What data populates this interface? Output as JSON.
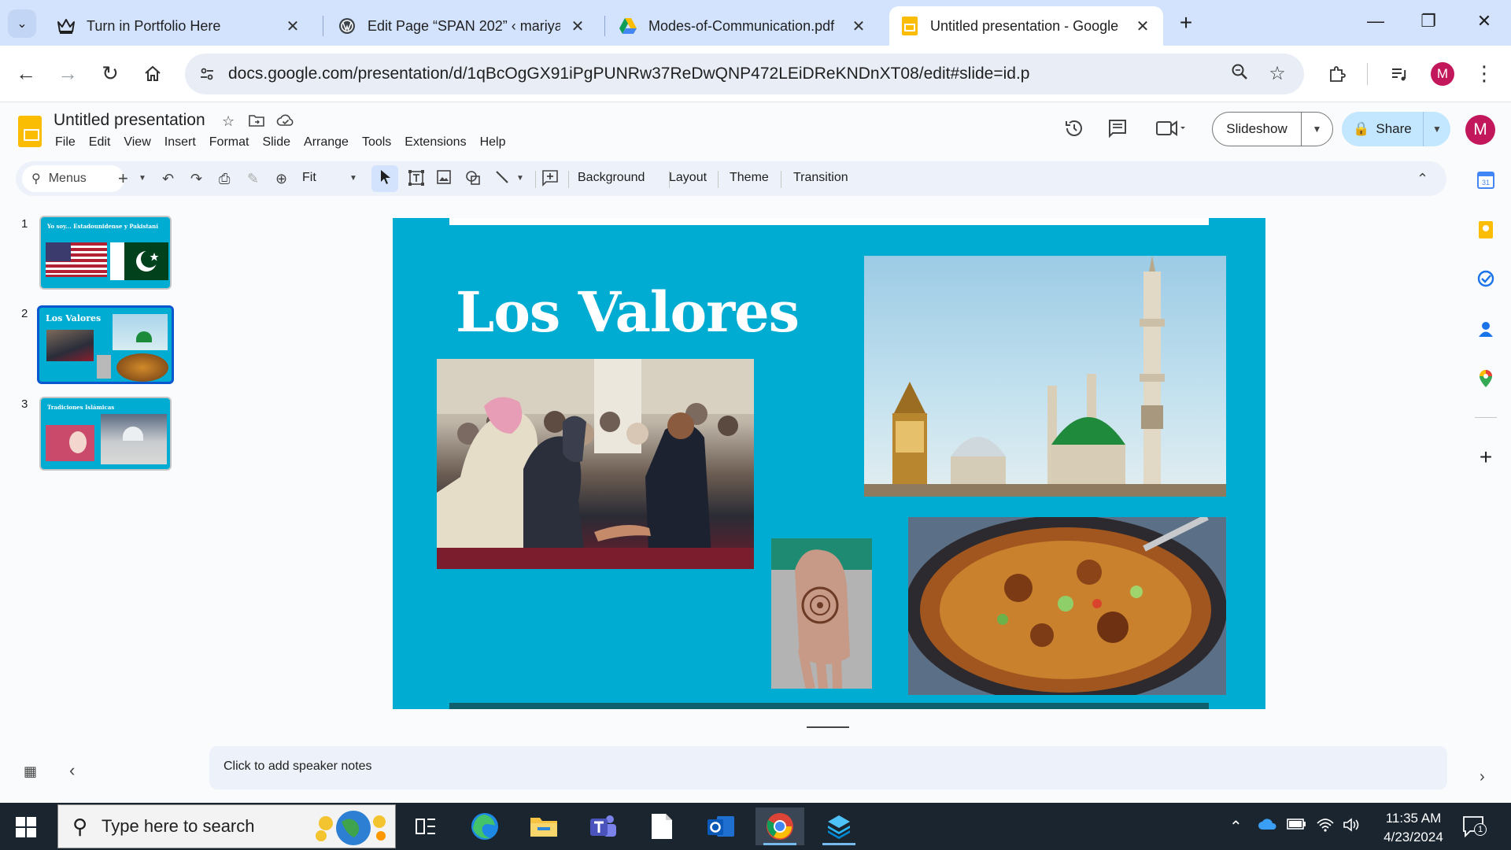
{
  "browser": {
    "tabs": [
      {
        "title": "Turn in Portfolio Here",
        "icon": "crown-icon"
      },
      {
        "title": "Edit Page “SPAN 202” ‹ mariya",
        "icon": "wordpress-icon"
      },
      {
        "title": "Modes-of-Communication.pdf",
        "icon": "google-drive-icon"
      },
      {
        "title": "Untitled presentation - Google",
        "icon": "google-slides-icon"
      }
    ],
    "url": "docs.google.com/presentation/d/1qBcOgGX91iPgPUNRw37ReDwQNP472LEiDReKNDnXT08/edit#slide=id.p",
    "profile_initial": "M"
  },
  "doc": {
    "title": "Untitled presentation",
    "menu": [
      "File",
      "Edit",
      "View",
      "Insert",
      "Format",
      "Slide",
      "Arrange",
      "Tools",
      "Extensions",
      "Help"
    ],
    "slideshow_label": "Slideshow",
    "share_label": "Share",
    "avatar_initial": "M"
  },
  "toolbar": {
    "search_label": "Menus",
    "zoom_label": "Fit",
    "background_label": "Background",
    "layout_label": "Layout",
    "theme_label": "Theme",
    "transition_label": "Transition"
  },
  "filmstrip": {
    "slides": [
      {
        "number": "1",
        "title": "Yo soy... Estadounidense y Pakistaní"
      },
      {
        "number": "2",
        "title": "Los Valores"
      },
      {
        "number": "3",
        "title": "Tradiciones Islámicas"
      }
    ],
    "selected_index": 1
  },
  "slide": {
    "title": "Los Valores",
    "colors": {
      "background": "#00acd2",
      "top_bar": "#ffffff",
      "bottom_bar": "#0f5f6c"
    }
  },
  "notes": {
    "placeholder": "Click to add speaker notes"
  },
  "taskbar": {
    "search_placeholder": "Type here to search",
    "time": "11:35 AM",
    "date": "4/23/2024",
    "notification_count": "1"
  }
}
